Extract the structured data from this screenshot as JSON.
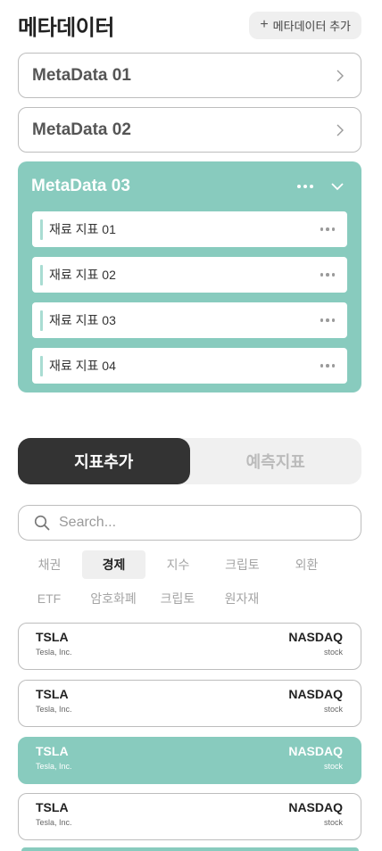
{
  "header": {
    "title": "메타데이터",
    "add_button": "메타데이터 추가"
  },
  "metadata": [
    {
      "label": "MetaData 01"
    },
    {
      "label": "MetaData 02"
    }
  ],
  "metadata_open": {
    "label": "MetaData 03",
    "items": [
      {
        "label": "재료 지표 01"
      },
      {
        "label": "재료 지표 02"
      },
      {
        "label": "재료 지표 03"
      },
      {
        "label": "재료 지표 04"
      }
    ]
  },
  "toggle": {
    "add": "지표추가",
    "predict": "예측지표"
  },
  "search": {
    "placeholder": "Search..."
  },
  "categories_row1": [
    "채권",
    "경제",
    "지수",
    "크립토",
    "외환"
  ],
  "categories_row2": [
    "ETF",
    "암호화폐",
    "크립토",
    "원자재"
  ],
  "selected_category": "경제",
  "stocks": [
    {
      "ticker": "TSLA",
      "exchange": "NASDAQ",
      "name": "Tesla, Inc.",
      "type": "stock"
    },
    {
      "ticker": "TSLA",
      "exchange": "NASDAQ",
      "name": "Tesla, Inc.",
      "type": "stock"
    },
    {
      "ticker": "TSLA",
      "exchange": "NASDAQ",
      "name": "Tesla, Inc.",
      "type": "stock"
    },
    {
      "ticker": "TSLA",
      "exchange": "NASDAQ",
      "name": "Tesla, Inc.",
      "type": "stock"
    }
  ],
  "colors": {
    "accent": "#88cbbe",
    "dark": "#333333",
    "border": "#bdbdbd"
  }
}
